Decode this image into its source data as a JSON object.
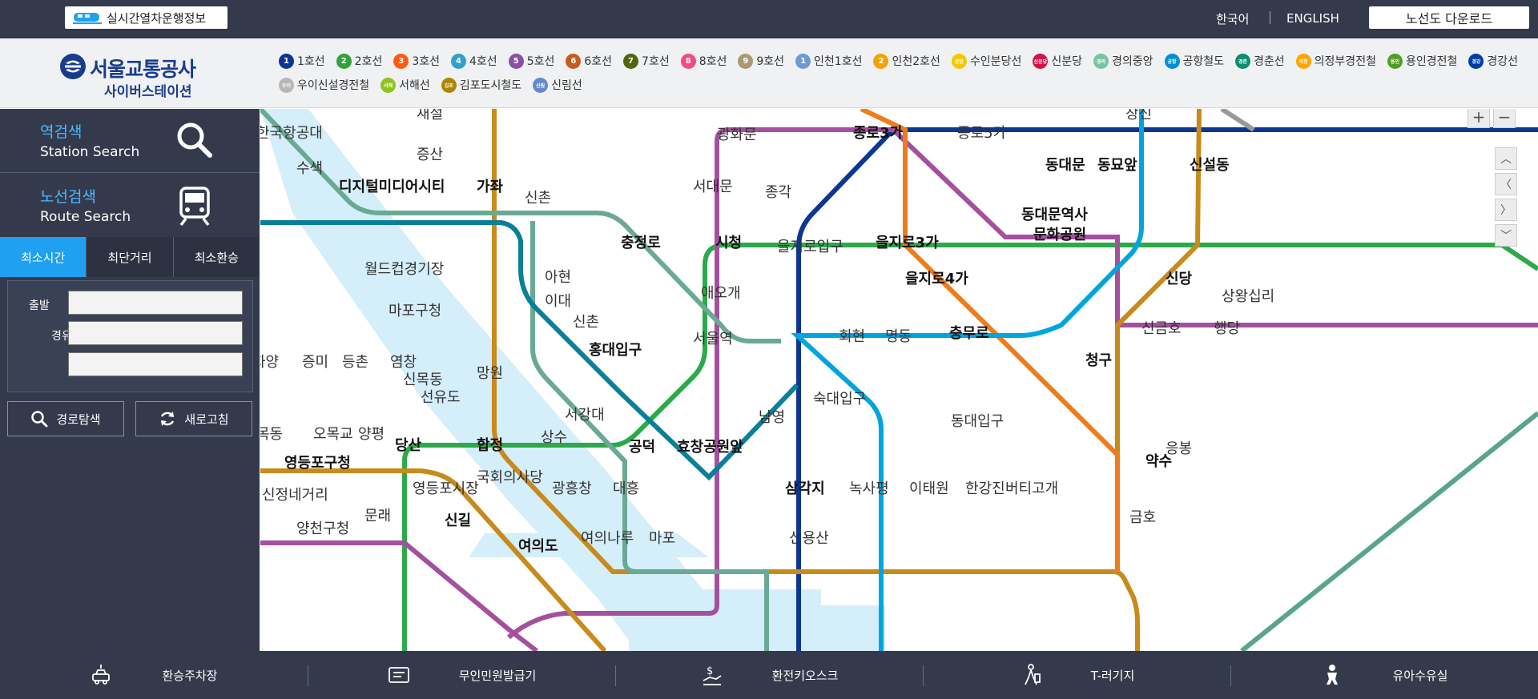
{
  "topbar": {
    "realtime": "실시간열차운행정보",
    "lang_ko": "한국어",
    "lang_en": "ENGLISH",
    "download": "노선도 다운로드"
  },
  "logo": {
    "line1": "서울교통공사",
    "line2": "사이버스테이션"
  },
  "legend": [
    {
      "mark": "1",
      "label": "1호선",
      "color": "#0d3692"
    },
    {
      "mark": "2",
      "label": "2호선",
      "color": "#33a23d"
    },
    {
      "mark": "3",
      "label": "3호선",
      "color": "#fe5b10"
    },
    {
      "mark": "4",
      "label": "4호선",
      "color": "#32a1c8"
    },
    {
      "mark": "5",
      "label": "5호선",
      "color": "#8b50a4"
    },
    {
      "mark": "6",
      "label": "6호선",
      "color": "#c55c1d"
    },
    {
      "mark": "7",
      "label": "7호선",
      "color": "#54640d"
    },
    {
      "mark": "8",
      "label": "8호선",
      "color": "#f14c82"
    },
    {
      "mark": "9",
      "label": "9호선",
      "color": "#aa9872"
    },
    {
      "mark": "1",
      "label": "인천1호선",
      "color": "#6f99d0"
    },
    {
      "mark": "2",
      "label": "인천2호선",
      "color": "#f5a200"
    },
    {
      "mark": "분당",
      "label": "수인분당선",
      "color": "#f5c900"
    },
    {
      "mark": "신분당",
      "label": "신분당",
      "color": "#d31145"
    },
    {
      "mark": "경의",
      "label": "경의중앙",
      "color": "#77c4a3"
    },
    {
      "mark": "공항",
      "label": "공항철도",
      "color": "#0090d2"
    },
    {
      "mark": "경춘",
      "label": "경춘선",
      "color": "#0c8e72"
    },
    {
      "mark": "의정",
      "label": "의정부경전철",
      "color": "#fda600"
    },
    {
      "mark": "용인",
      "label": "용인경전철",
      "color": "#509f22"
    },
    {
      "mark": "경강",
      "label": "경강선",
      "color": "#003da5"
    },
    {
      "mark": "우이",
      "label": "우이신설경전철",
      "color": "#b7b7b7"
    },
    {
      "mark": "서해",
      "label": "서해선",
      "color": "#8fc31f"
    },
    {
      "mark": "김포",
      "label": "김포도시철도",
      "color": "#ad8605"
    },
    {
      "mark": "신림",
      "label": "신림선",
      "color": "#6789ca"
    }
  ],
  "sidebar": {
    "station_search": {
      "ko": "역검색",
      "en": "Station Search"
    },
    "route_search": {
      "ko": "노선검색",
      "en": "Route Search"
    },
    "tabs": [
      "최소시간",
      "최단거리",
      "최소환승"
    ],
    "labels": {
      "from": "출발",
      "via": "경유"
    },
    "buttons": {
      "search": "경로탐색",
      "refresh": "새로고침"
    }
  },
  "map": {
    "zoom_in": "+",
    "zoom_out": "−",
    "stations": [
      "종로3가",
      "종로5가",
      "광화문",
      "창신",
      "동대문",
      "동묘앞",
      "신설동",
      "한국항공대",
      "수색",
      "증산",
      "새절",
      "디지털미디어시티",
      "가좌",
      "신촌",
      "서대문",
      "종각",
      "충정로",
      "시청",
      "을지로입구",
      "을지로3가",
      "을지로4가",
      "동대문역사",
      "문화공원",
      "신당",
      "상왕십리",
      "월드컵경기장",
      "아현",
      "애오개",
      "이대",
      "마포구청",
      "신촌",
      "서울역",
      "회현",
      "명동",
      "충무로",
      "청구",
      "신금호",
      "행당",
      "홍대입구",
      "망원",
      "신목동",
      "선유도",
      "화양",
      "증미",
      "등촌",
      "염창",
      "목동",
      "오목교",
      "양평",
      "영등포구청",
      "당산",
      "합정",
      "상수",
      "서강대",
      "공덕",
      "효창공원앞",
      "남영",
      "숙대입구",
      "동대입구",
      "약수",
      "응봉",
      "국회의사당",
      "광흥창",
      "대흥",
      "삼각지",
      "녹사평",
      "이태원",
      "한강진",
      "버티고개",
      "금호",
      "신정네거리",
      "문래",
      "영등포시장",
      "신길",
      "여의나루",
      "마포",
      "신용산",
      "양천구청",
      "여의도"
    ]
  },
  "footer": [
    "환승주차장",
    "무인민원발급기",
    "환전키오스크",
    "T-러기지",
    "유아수유실"
  ]
}
